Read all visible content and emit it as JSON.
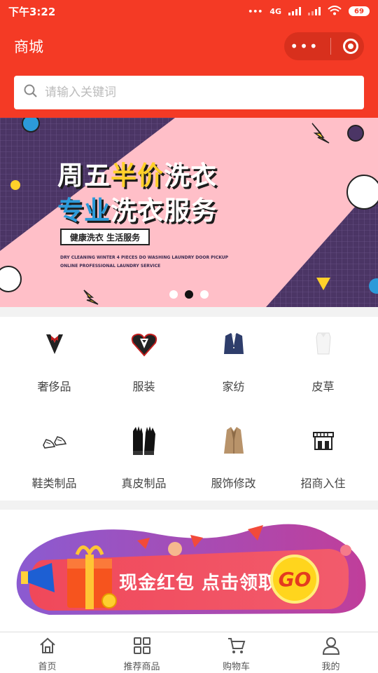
{
  "status": {
    "time": "下午3:22",
    "network": "4G",
    "battery": "69"
  },
  "header": {
    "title": "商城"
  },
  "search": {
    "placeholder": "请输入关键词"
  },
  "banner": {
    "line1_a": "周五",
    "line1_b": "半价",
    "line1_c": "洗衣",
    "line2_a": "专业",
    "line2_b": "洗衣服务",
    "badge": "健康洗衣 生活服务",
    "small1": "DRY CLEANING WINTER 4 PIECES DO WASHING LAUNDRY DOOR PICKUP",
    "small2": "ONLINE PROFESSIONAL LAUNDRY SERVICE",
    "active_slide": 2,
    "slide_count": 3
  },
  "categories": [
    {
      "label": "奢侈品",
      "icon": "tuxedo-icon"
    },
    {
      "label": "服装",
      "icon": "heart-suit-icon"
    },
    {
      "label": "家纺",
      "icon": "blazer-icon"
    },
    {
      "label": "皮草",
      "icon": "white-shirt-icon"
    },
    {
      "label": "鞋类制品",
      "icon": "sneakers-icon"
    },
    {
      "label": "真皮制品",
      "icon": "leather-gloves-icon"
    },
    {
      "label": "服饰修改",
      "icon": "trench-coat-icon"
    },
    {
      "label": "招商入住",
      "icon": "storefront-icon"
    }
  ],
  "promo": {
    "text": "现金红包 点击领取",
    "go": "GO"
  },
  "tabbar": [
    {
      "label": "首页",
      "icon": "home-icon"
    },
    {
      "label": "推荐商品",
      "icon": "grid-icon"
    },
    {
      "label": "购物车",
      "icon": "cart-icon"
    },
    {
      "label": "我的",
      "icon": "user-icon"
    }
  ],
  "colors": {
    "brand": "#f43a25",
    "banner_pink": "#ffbfc8",
    "banner_purple": "#4b3565",
    "accent_yellow": "#ffd02a"
  }
}
